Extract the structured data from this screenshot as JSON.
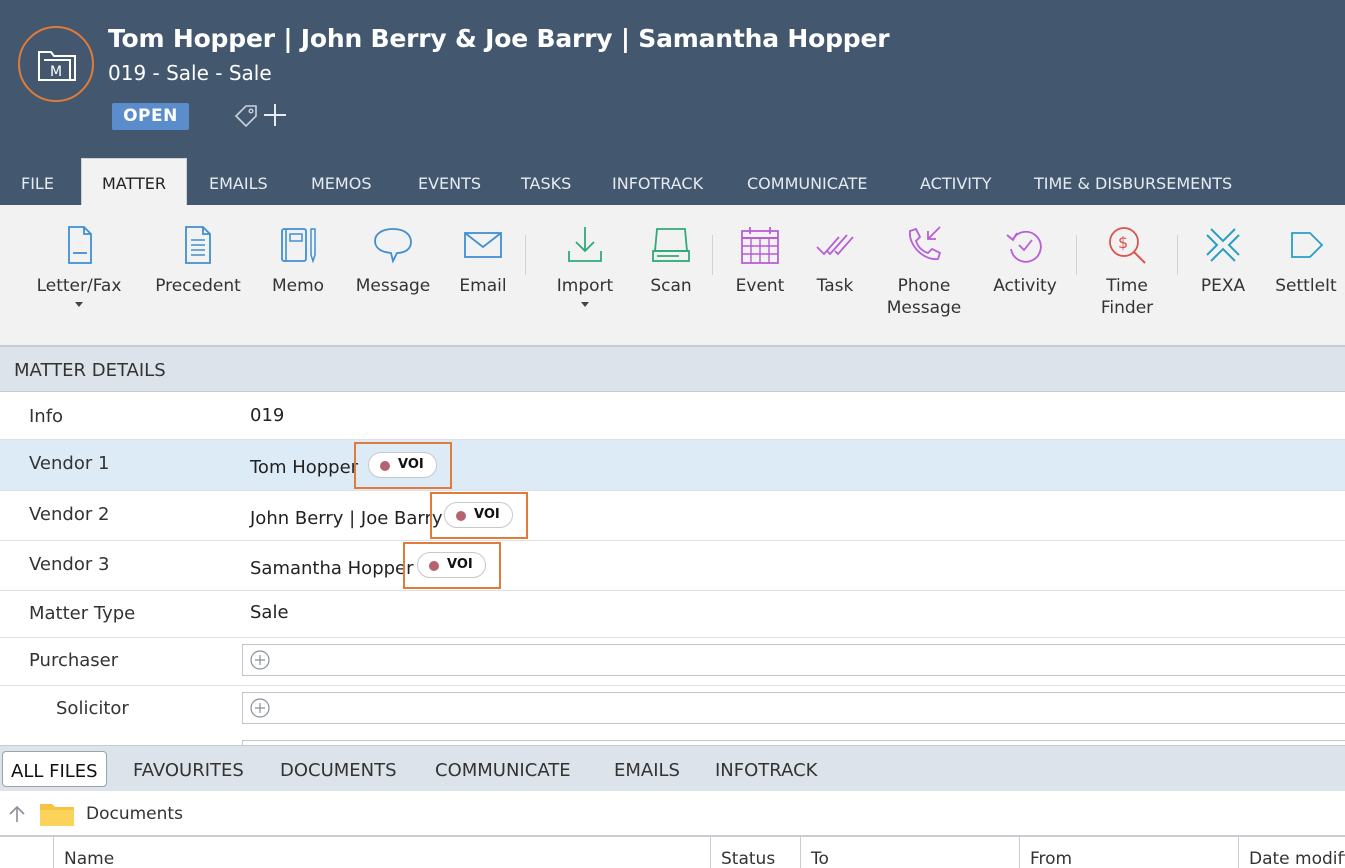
{
  "header": {
    "title": "Tom Hopper | John Berry & Joe Barry | Samantha Hopper",
    "subtitle": "019 - Sale - Sale",
    "status": "OPEN",
    "logo_icon": "matter-folder-icon"
  },
  "tabs": [
    "FILE",
    "MATTER",
    "EMAILS",
    "MEMOS",
    "EVENTS",
    "TASKS",
    "INFOTRACK",
    "COMMUNICATE",
    "ACTIVITY",
    "TIME & DISBURSEMENTS"
  ],
  "active_tab": "MATTER",
  "ribbon": [
    {
      "label": "Letter/Fax",
      "icon": "letter-icon"
    },
    {
      "label": "Precedent",
      "icon": "precedent-icon"
    },
    {
      "label": "Memo",
      "icon": "memo-icon"
    },
    {
      "label": "Message",
      "icon": "message-icon"
    },
    {
      "label": "Email",
      "icon": "email-icon"
    },
    {
      "label": "Import",
      "icon": "import-icon"
    },
    {
      "label": "Scan",
      "icon": "scan-icon"
    },
    {
      "label": "Event",
      "icon": "calendar-icon"
    },
    {
      "label": "Task",
      "icon": "task-icon"
    },
    {
      "label": "Phone Message",
      "line1": "Phone",
      "line2": "Message",
      "icon": "phone-message-icon"
    },
    {
      "label": "Activity",
      "icon": "activity-icon"
    },
    {
      "label": "Time Finder",
      "line1": "Time",
      "line2": "Finder",
      "icon": "time-finder-icon"
    },
    {
      "label": "PEXA",
      "icon": "pexa-icon"
    },
    {
      "label": "SettleIt",
      "icon": "settleit-icon"
    }
  ],
  "colors": {
    "header_bg": "#43586f",
    "accent_orange": "#e07b39",
    "status_blue": "#5b8ccb",
    "icon_blue": "#3f8fd2",
    "icon_green": "#2faa77",
    "icon_purple": "#b85ed6",
    "icon_red": "#d9534f",
    "voi_dot": "#b56370"
  },
  "matter_details": {
    "heading": "MATTER DETAILS",
    "rows": [
      {
        "label": "Info",
        "value": "019"
      },
      {
        "label": "Vendor 1",
        "value": "Tom Hopper",
        "badge": "VOI"
      },
      {
        "label": "Vendor 2",
        "value": "John Berry | Joe Barry",
        "badge": "VOI"
      },
      {
        "label": "Vendor 3",
        "value": "Samantha Hopper",
        "badge": "VOI"
      },
      {
        "label": "Matter Type",
        "value": "Sale"
      },
      {
        "label": "Purchaser",
        "value": ""
      },
      {
        "label": "Solicitor",
        "value": ""
      }
    ]
  },
  "bottom_tabs": [
    "ALL FILES",
    "FAVOURITES",
    "DOCUMENTS",
    "COMMUNICATE",
    "EMAILS",
    "INFOTRACK"
  ],
  "active_bottom_tab": "ALL FILES",
  "path": "Documents",
  "grid_columns": [
    "Name",
    "Status",
    "To",
    "From",
    "Date modified"
  ]
}
